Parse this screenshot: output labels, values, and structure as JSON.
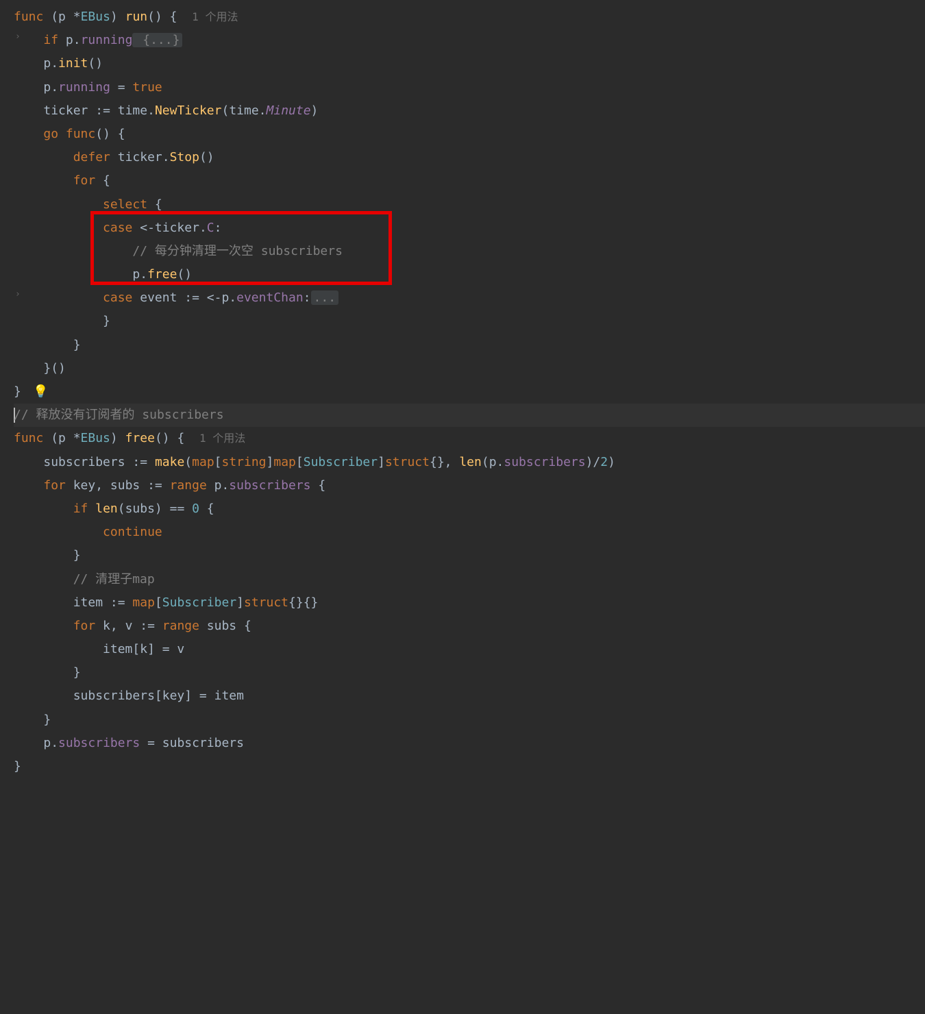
{
  "usage_hints": {
    "run": "1 个用法",
    "free": "1 个用法"
  },
  "code": {
    "l1": {
      "kw1": "func",
      "recv": "(p *",
      "type": "EBus",
      "recv2": ") ",
      "fn": "run",
      "paren": "() {"
    },
    "l2": {
      "kw": "if",
      "pre": " p.",
      "field": "running",
      "fold": " {...}"
    },
    "l3": {
      "pre": "p.",
      "fn": "init",
      "post": "()"
    },
    "l4": {
      "pre": "p.",
      "field": "running",
      "eq": " = ",
      "val": "true"
    },
    "l5": {
      "id": "ticker",
      "assign": " := ",
      "pkg": "time.",
      "fn": "NewTicker",
      "open": "(",
      "pkg2": "time.",
      "italic": "Minute",
      "close": ")"
    },
    "l6": {
      "kw1": "go",
      "kw2": " func",
      "post": "() {"
    },
    "l7": {
      "kw": "defer",
      "pre": " ticker.",
      "fn": "Stop",
      "post": "()"
    },
    "l8": {
      "kw": "for",
      "post": " {"
    },
    "l9": {
      "kw": "select",
      "post": " {"
    },
    "l10": {
      "kw": "case",
      "arrow": " <-ticker.",
      "field": "C",
      "colon": ":"
    },
    "l11": {
      "comment": "// 每分钟清理一次空 subscribers"
    },
    "l12": {
      "pre": "p.",
      "fn": "free",
      "post": "()"
    },
    "l13": {
      "kw": "case",
      "mid": " event := <-p.",
      "field": "eventChan",
      "colon": ":",
      "fold": "..."
    },
    "l14": {
      "brace": "}"
    },
    "l15": {
      "brace": "}"
    },
    "l16": {
      "brace": "}()"
    },
    "l17": {
      "brace": "}"
    },
    "l18": {
      "comment": "// 释放没有订阅者的 subscribers"
    },
    "l19": {
      "kw1": "func",
      "recv": " (p *",
      "type": "EBus",
      "recv2": ") ",
      "fn": "free",
      "paren": "() {"
    },
    "l20": {
      "id": "subscribers",
      "assign": " := ",
      "fn": "make",
      "open": "(",
      "kw": "map",
      "br": "[",
      "str": "string",
      "br2": "]",
      "kw2": "map",
      "br3": "[",
      "sub": "Subscriber",
      "br4": "]",
      "kw3": "struct",
      "post": "{}, ",
      "fn2": "len",
      "open2": "(p.",
      "field": "subscribers",
      "close": ")/",
      "num": "2",
      "close2": ")"
    },
    "l21": {
      "kw": "for",
      "mid": " key, subs := ",
      "kw2": "range",
      "pre": " p.",
      "field": "subscribers",
      "post": " {"
    },
    "l22": {
      "kw": "if",
      "fn": " len",
      "open": "(subs) == ",
      "num": "0",
      "post": " {"
    },
    "l23": {
      "kw": "continue"
    },
    "l24": {
      "brace": "}"
    },
    "l25": {
      "comment": "// 清理子map"
    },
    "l26": {
      "id": "item",
      "assign": " := ",
      "kw": "map",
      "br": "[",
      "sub": "Subscriber",
      "br2": "]",
      "kw2": "struct",
      "post": "{}{}"
    },
    "l27": {
      "kw": "for",
      "mid": " k, v := ",
      "kw2": "range",
      "post": " subs {"
    },
    "l28": {
      "text": "item[k] = v"
    },
    "l29": {
      "brace": "}"
    },
    "l30": {
      "text": "subscribers[key] = item"
    },
    "l31": {
      "brace": "}"
    },
    "l32": {
      "pre": "p.",
      "field": "subscribers",
      "post": " = subscribers"
    },
    "l33": {
      "brace": "}"
    }
  },
  "bulb": "💡"
}
